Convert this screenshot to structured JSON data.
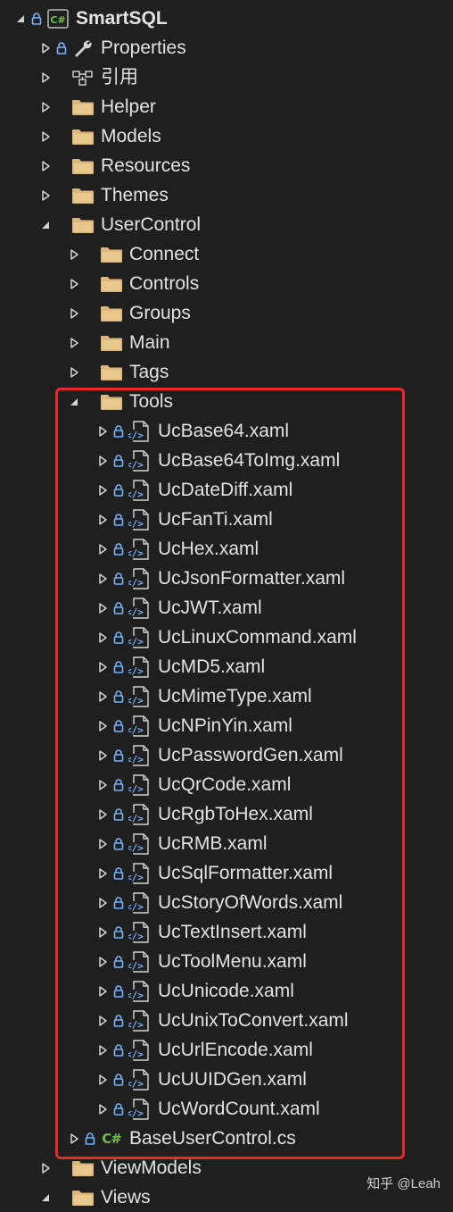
{
  "solution": {
    "project_name": "SmartSQL",
    "items": [
      {
        "label": "Properties",
        "depth": 1,
        "expanded": false,
        "icon": "wrench-icon",
        "lock": true,
        "bold": false
      },
      {
        "label": "引用",
        "depth": 1,
        "expanded": false,
        "icon": "references-icon",
        "lock": false,
        "bold": false
      },
      {
        "label": "Helper",
        "depth": 1,
        "expanded": false,
        "icon": "folder-icon",
        "lock": false,
        "bold": false
      },
      {
        "label": "Models",
        "depth": 1,
        "expanded": false,
        "icon": "folder-icon",
        "lock": false,
        "bold": false
      },
      {
        "label": "Resources",
        "depth": 1,
        "expanded": false,
        "icon": "folder-icon",
        "lock": false,
        "bold": false
      },
      {
        "label": "Themes",
        "depth": 1,
        "expanded": false,
        "icon": "folder-icon",
        "lock": false,
        "bold": false
      },
      {
        "label": "UserControl",
        "depth": 1,
        "expanded": true,
        "icon": "folder-icon",
        "lock": false,
        "bold": false
      },
      {
        "label": "Connect",
        "depth": 2,
        "expanded": false,
        "icon": "folder-icon",
        "lock": false,
        "bold": false
      },
      {
        "label": "Controls",
        "depth": 2,
        "expanded": false,
        "icon": "folder-icon",
        "lock": false,
        "bold": false
      },
      {
        "label": "Groups",
        "depth": 2,
        "expanded": false,
        "icon": "folder-icon",
        "lock": false,
        "bold": false
      },
      {
        "label": "Main",
        "depth": 2,
        "expanded": false,
        "icon": "folder-icon",
        "lock": false,
        "bold": false
      },
      {
        "label": "Tags",
        "depth": 2,
        "expanded": false,
        "icon": "folder-icon",
        "lock": false,
        "bold": false
      },
      {
        "label": "Tools",
        "depth": 2,
        "expanded": true,
        "icon": "folder-icon",
        "lock": false,
        "bold": false
      },
      {
        "label": "UcBase64.xaml",
        "depth": 3,
        "expanded": false,
        "icon": "xaml-file-icon",
        "lock": true,
        "bold": false
      },
      {
        "label": "UcBase64ToImg.xaml",
        "depth": 3,
        "expanded": false,
        "icon": "xaml-file-icon",
        "lock": true,
        "bold": false
      },
      {
        "label": "UcDateDiff.xaml",
        "depth": 3,
        "expanded": false,
        "icon": "xaml-file-icon",
        "lock": true,
        "bold": false
      },
      {
        "label": "UcFanTi.xaml",
        "depth": 3,
        "expanded": false,
        "icon": "xaml-file-icon",
        "lock": true,
        "bold": false
      },
      {
        "label": "UcHex.xaml",
        "depth": 3,
        "expanded": false,
        "icon": "xaml-file-icon",
        "lock": true,
        "bold": false
      },
      {
        "label": "UcJsonFormatter.xaml",
        "depth": 3,
        "expanded": false,
        "icon": "xaml-file-icon",
        "lock": true,
        "bold": false
      },
      {
        "label": "UcJWT.xaml",
        "depth": 3,
        "expanded": false,
        "icon": "xaml-file-icon",
        "lock": true,
        "bold": false
      },
      {
        "label": "UcLinuxCommand.xaml",
        "depth": 3,
        "expanded": false,
        "icon": "xaml-file-icon",
        "lock": true,
        "bold": false
      },
      {
        "label": "UcMD5.xaml",
        "depth": 3,
        "expanded": false,
        "icon": "xaml-file-icon",
        "lock": true,
        "bold": false
      },
      {
        "label": "UcMimeType.xaml",
        "depth": 3,
        "expanded": false,
        "icon": "xaml-file-icon",
        "lock": true,
        "bold": false
      },
      {
        "label": "UcNPinYin.xaml",
        "depth": 3,
        "expanded": false,
        "icon": "xaml-file-icon",
        "lock": true,
        "bold": false
      },
      {
        "label": "UcPasswordGen.xaml",
        "depth": 3,
        "expanded": false,
        "icon": "xaml-file-icon",
        "lock": true,
        "bold": false
      },
      {
        "label": "UcQrCode.xaml",
        "depth": 3,
        "expanded": false,
        "icon": "xaml-file-icon",
        "lock": true,
        "bold": false
      },
      {
        "label": "UcRgbToHex.xaml",
        "depth": 3,
        "expanded": false,
        "icon": "xaml-file-icon",
        "lock": true,
        "bold": false
      },
      {
        "label": "UcRMB.xaml",
        "depth": 3,
        "expanded": false,
        "icon": "xaml-file-icon",
        "lock": true,
        "bold": false
      },
      {
        "label": "UcSqlFormatter.xaml",
        "depth": 3,
        "expanded": false,
        "icon": "xaml-file-icon",
        "lock": true,
        "bold": false
      },
      {
        "label": "UcStoryOfWords.xaml",
        "depth": 3,
        "expanded": false,
        "icon": "xaml-file-icon",
        "lock": true,
        "bold": false
      },
      {
        "label": "UcTextInsert.xaml",
        "depth": 3,
        "expanded": false,
        "icon": "xaml-file-icon",
        "lock": true,
        "bold": false
      },
      {
        "label": "UcToolMenu.xaml",
        "depth": 3,
        "expanded": false,
        "icon": "xaml-file-icon",
        "lock": true,
        "bold": false
      },
      {
        "label": "UcUnicode.xaml",
        "depth": 3,
        "expanded": false,
        "icon": "xaml-file-icon",
        "lock": true,
        "bold": false
      },
      {
        "label": "UcUnixToConvert.xaml",
        "depth": 3,
        "expanded": false,
        "icon": "xaml-file-icon",
        "lock": true,
        "bold": false
      },
      {
        "label": "UcUrlEncode.xaml",
        "depth": 3,
        "expanded": false,
        "icon": "xaml-file-icon",
        "lock": true,
        "bold": false
      },
      {
        "label": "UcUUIDGen.xaml",
        "depth": 3,
        "expanded": false,
        "icon": "xaml-file-icon",
        "lock": true,
        "bold": false
      },
      {
        "label": "UcWordCount.xaml",
        "depth": 3,
        "expanded": false,
        "icon": "xaml-file-icon",
        "lock": true,
        "bold": false
      },
      {
        "label": "BaseUserControl.cs",
        "depth": 2,
        "expanded": false,
        "icon": "csharp-file-icon",
        "lock": true,
        "bold": false
      },
      {
        "label": "ViewModels",
        "depth": 1,
        "expanded": false,
        "icon": "folder-icon",
        "lock": false,
        "bold": false
      },
      {
        "label": "Views",
        "depth": 1,
        "expanded": true,
        "icon": "folder-icon",
        "lock": false,
        "bold": false
      }
    ]
  },
  "watermark": "知乎 @Leah",
  "colors": {
    "background": "#1f1f1f",
    "text": "#e2e2e2",
    "folder": "#dcb67a",
    "lock": "#75b4ff",
    "csharp": "#6fbf4a",
    "highlight_border": "#e8282a"
  }
}
